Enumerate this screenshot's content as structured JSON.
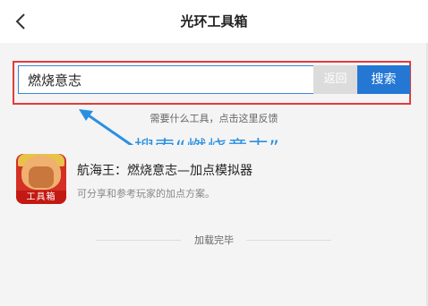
{
  "header": {
    "title": "光环工具箱",
    "back_icon": "chevron-left-icon"
  },
  "search": {
    "value": "燃烧意志",
    "return_label": "返回",
    "search_label": "搜索",
    "hint": "需要什么工具，点击这里反馈"
  },
  "annotation": {
    "text": "搜索“燃烧意志”",
    "color": "#2b8fe0"
  },
  "results": [
    {
      "title": "航海王：燃烧意志—加点模拟器",
      "description": "可分享和参考玩家的加点方案。",
      "icon_badge": "工具箱"
    }
  ],
  "footer": {
    "text": "加载完毕"
  },
  "colors": {
    "accent": "#2478d4",
    "highlight_frame": "#e33b3b"
  }
}
